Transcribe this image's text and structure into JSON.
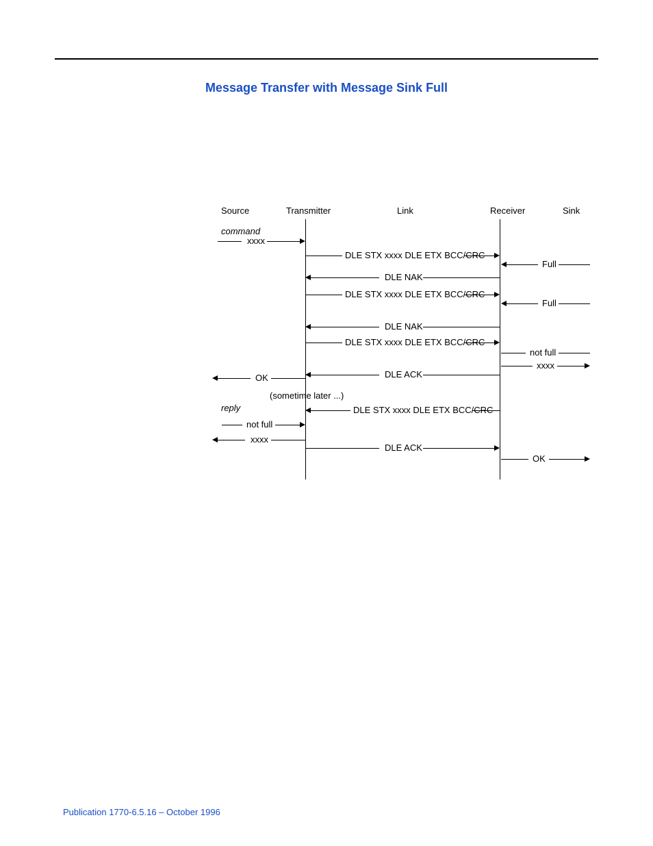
{
  "page": {
    "title": "Message Transfer with Message Sink Full",
    "footer": "Publication 1770-6.5.16 – October 1996"
  },
  "headers": {
    "source": "Source",
    "transmitter": "Transmitter",
    "link": "Link",
    "receiver": "Receiver",
    "sink": "Sink"
  },
  "labels": {
    "command": "command",
    "reply": "reply",
    "xxxx": "xxxx",
    "ok": "OK",
    "full": "Full",
    "not_full": "not full",
    "sometime_later": "(sometime later ...)",
    "dle_stx": "DLE STX xxxx DLE ETX BCC/CRC",
    "dle_nak": "DLE NAK",
    "dle_ack": "DLE ACK"
  }
}
